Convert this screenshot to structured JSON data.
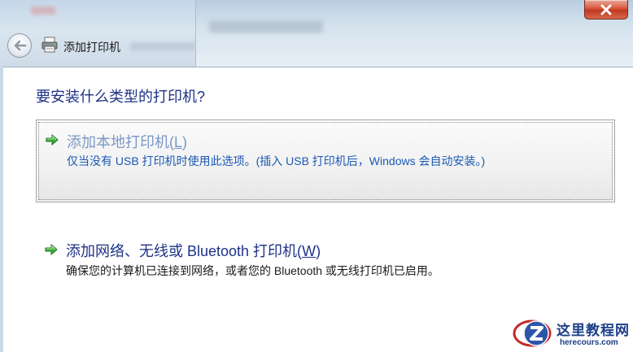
{
  "window": {
    "title": "添加打印机",
    "close_icon": "close-icon",
    "back_icon": "back-arrow-icon",
    "app_icon": "printer-icon"
  },
  "main": {
    "question": "要安装什么类型的打印机?",
    "options": [
      {
        "title": "添加本地打印机(",
        "accelerator": "L",
        "title_end": ")",
        "description": "仅当没有 USB 打印机时使用此选项。(插入 USB 打印机后，Windows 会自动安装。)",
        "icon": "green-arrow-icon",
        "selected": true
      },
      {
        "title": "添加网络、无线或 Bluetooth 打印机(",
        "accelerator": "W",
        "title_end": ")",
        "description": "确保您的计算机已连接到网络，或者您的 Bluetooth 或无线打印机已启用。",
        "icon": "green-arrow-icon",
        "selected": false
      }
    ]
  },
  "watermark": {
    "name": "这里教程网",
    "site": "herecours.com"
  },
  "colors": {
    "link_blue": "#1e3287",
    "hover_text": "#7a98c6",
    "desc_blue": "#1b59b3",
    "close_red": "#c0391f",
    "arrow_green": "#2e9e2e"
  }
}
